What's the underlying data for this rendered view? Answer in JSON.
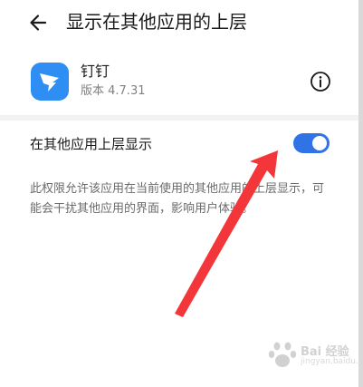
{
  "header": {
    "title": "显示在其他应用的上层",
    "back_icon": "back-arrow-icon"
  },
  "app": {
    "name": "钉钉",
    "version": "版本 4.7.31",
    "icon": "dingtalk-app-icon",
    "icon_color": "#2f8ef4"
  },
  "setting": {
    "label": "在其他应用上层显示",
    "enabled": true,
    "toggle_color": "#2f73e6"
  },
  "description": "此权限允许该应用在当前使用的其他应用的上层显示，可能会干扰其他应用的界面，影响用户体验。",
  "annotation": {
    "arrow_color": "#f2363a"
  },
  "watermark": {
    "text": "Bai 经验",
    "sub": "jingyan.baidu.com"
  }
}
